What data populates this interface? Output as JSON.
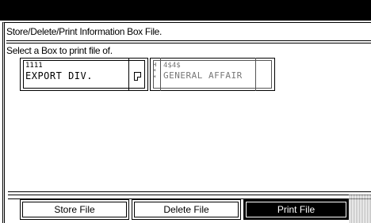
{
  "screen_title": "Store/Delete/Print Information Box File.",
  "instruction": "Select a Box to print file of.",
  "boxes": [
    {
      "number": "1111",
      "name": "EXPORT DIV.",
      "icon": "document-icon",
      "enabled": true
    },
    {
      "number": "4$4$",
      "name": "GENERAL AFFAIR",
      "lock_marks": "H\n*\n*",
      "enabled": false
    }
  ],
  "actions": {
    "store_label": "Store File",
    "delete_label": "Delete File",
    "print_label": "Print File"
  },
  "colors": {
    "background": "#ffffff",
    "foreground": "#000000",
    "selected": "#000000"
  }
}
